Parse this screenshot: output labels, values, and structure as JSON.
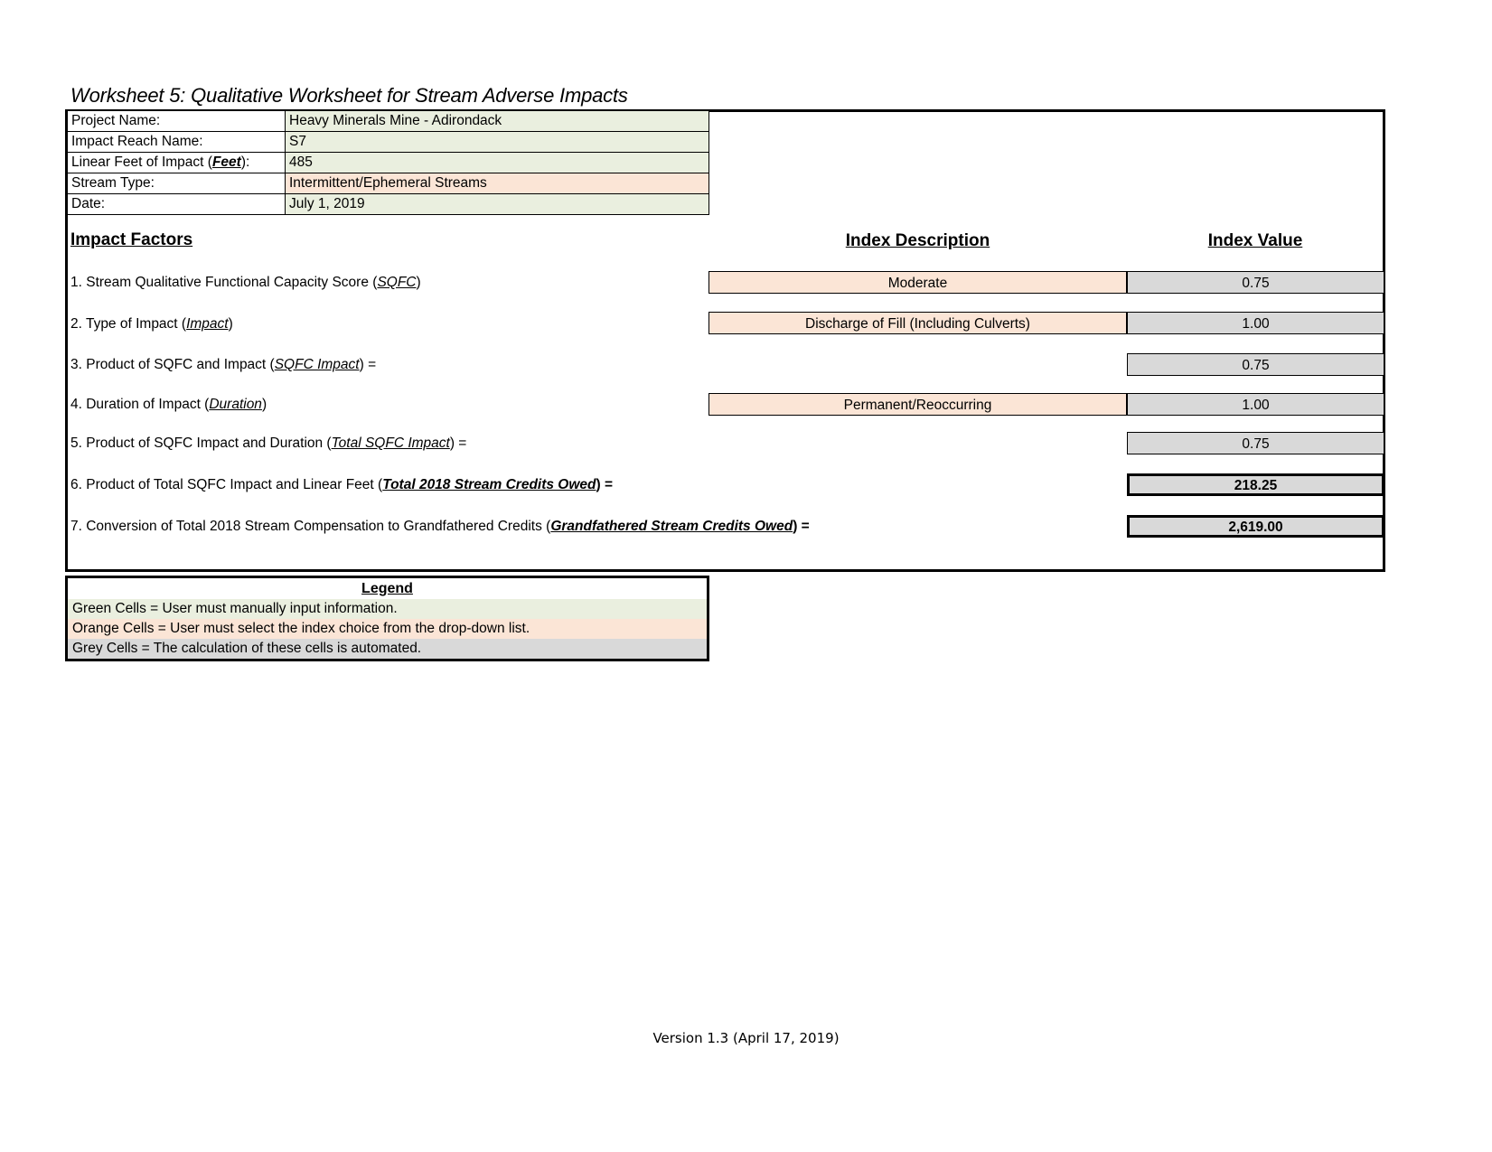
{
  "worksheet": {
    "title": "Worksheet 5:  Qualitative Worksheet for Stream Adverse Impacts"
  },
  "info_table": {
    "rows": [
      {
        "label": "Project Name:",
        "value": "Heavy Minerals Mine - Adirondack",
        "fill": "green"
      },
      {
        "label": "Impact Reach Name:",
        "value": "S7",
        "fill": "green"
      },
      {
        "label_pre": "Linear Feet of Impact (",
        "label_em": "Feet",
        "label_post": "):",
        "value": "485",
        "fill": "green"
      },
      {
        "label": "Stream Type:",
        "value": "Intermittent/Ephemeral Streams",
        "fill": "orange"
      },
      {
        "label": "Date:",
        "value": "July 1, 2019",
        "fill": "green"
      }
    ]
  },
  "headings": {
    "impact_factors": "Impact Factors",
    "index_description": "Index Description",
    "index_value": "Index Value"
  },
  "factors": [
    {
      "number": "1. ",
      "text_pre": "Stream Qualitative Functional Capacity Score (",
      "term": "SQFC",
      "text_post": ")",
      "description": "Moderate",
      "value": "0.75"
    },
    {
      "number": "2. ",
      "text_pre": "Type of Impact (",
      "term": "Impact",
      "text_post": ")",
      "description": "Discharge of Fill (Including Culverts)",
      "value": "1.00"
    },
    {
      "number": "3. ",
      "text_pre": "Product of SQFC and Impact (",
      "term": "SQFC Impact",
      "text_post": ") =",
      "description": null,
      "value": "0.75"
    },
    {
      "number": "4. ",
      "text_pre": "Duration of Impact (",
      "term": "Duration",
      "text_post": ")",
      "description": "Permanent/Reoccurring",
      "value": "1.00"
    },
    {
      "number": "5. ",
      "text_pre": "Product of SQFC Impact and Duration (",
      "term": "Total SQFC Impact",
      "text_post": ") =",
      "description": null,
      "value": "0.75"
    },
    {
      "number": "6. ",
      "text_pre": "Product of Total SQFC Impact and Linear Feet (",
      "term": "Total 2018 Stream Credits Owed",
      "text_post": ") =",
      "description": null,
      "value": "218.25"
    },
    {
      "number": "7. ",
      "text_pre": "Conversion of Total 2018 Stream Compensation to Grandfathered Credits (",
      "term": "Grandfathered Stream Credits Owed",
      "text_post": ") =",
      "description": null,
      "value": "2,619.00"
    }
  ],
  "legend": {
    "title": "Legend",
    "items": [
      {
        "text": "Green Cells = User must manually input information.",
        "fill": "green"
      },
      {
        "text": "Orange Cells = User must select the index choice from the drop-down list.",
        "fill": "orange"
      },
      {
        "text": "Grey Cells = The calculation of these cells is automated.",
        "fill": "grey"
      }
    ]
  },
  "footer": {
    "version": "Version 1.3 (April 17, 2019)"
  },
  "colors": {
    "green_fill": "#eaefdf",
    "orange_fill": "#fbe5d6",
    "grey_fill": "#d9d9d9",
    "border": "#000000"
  }
}
